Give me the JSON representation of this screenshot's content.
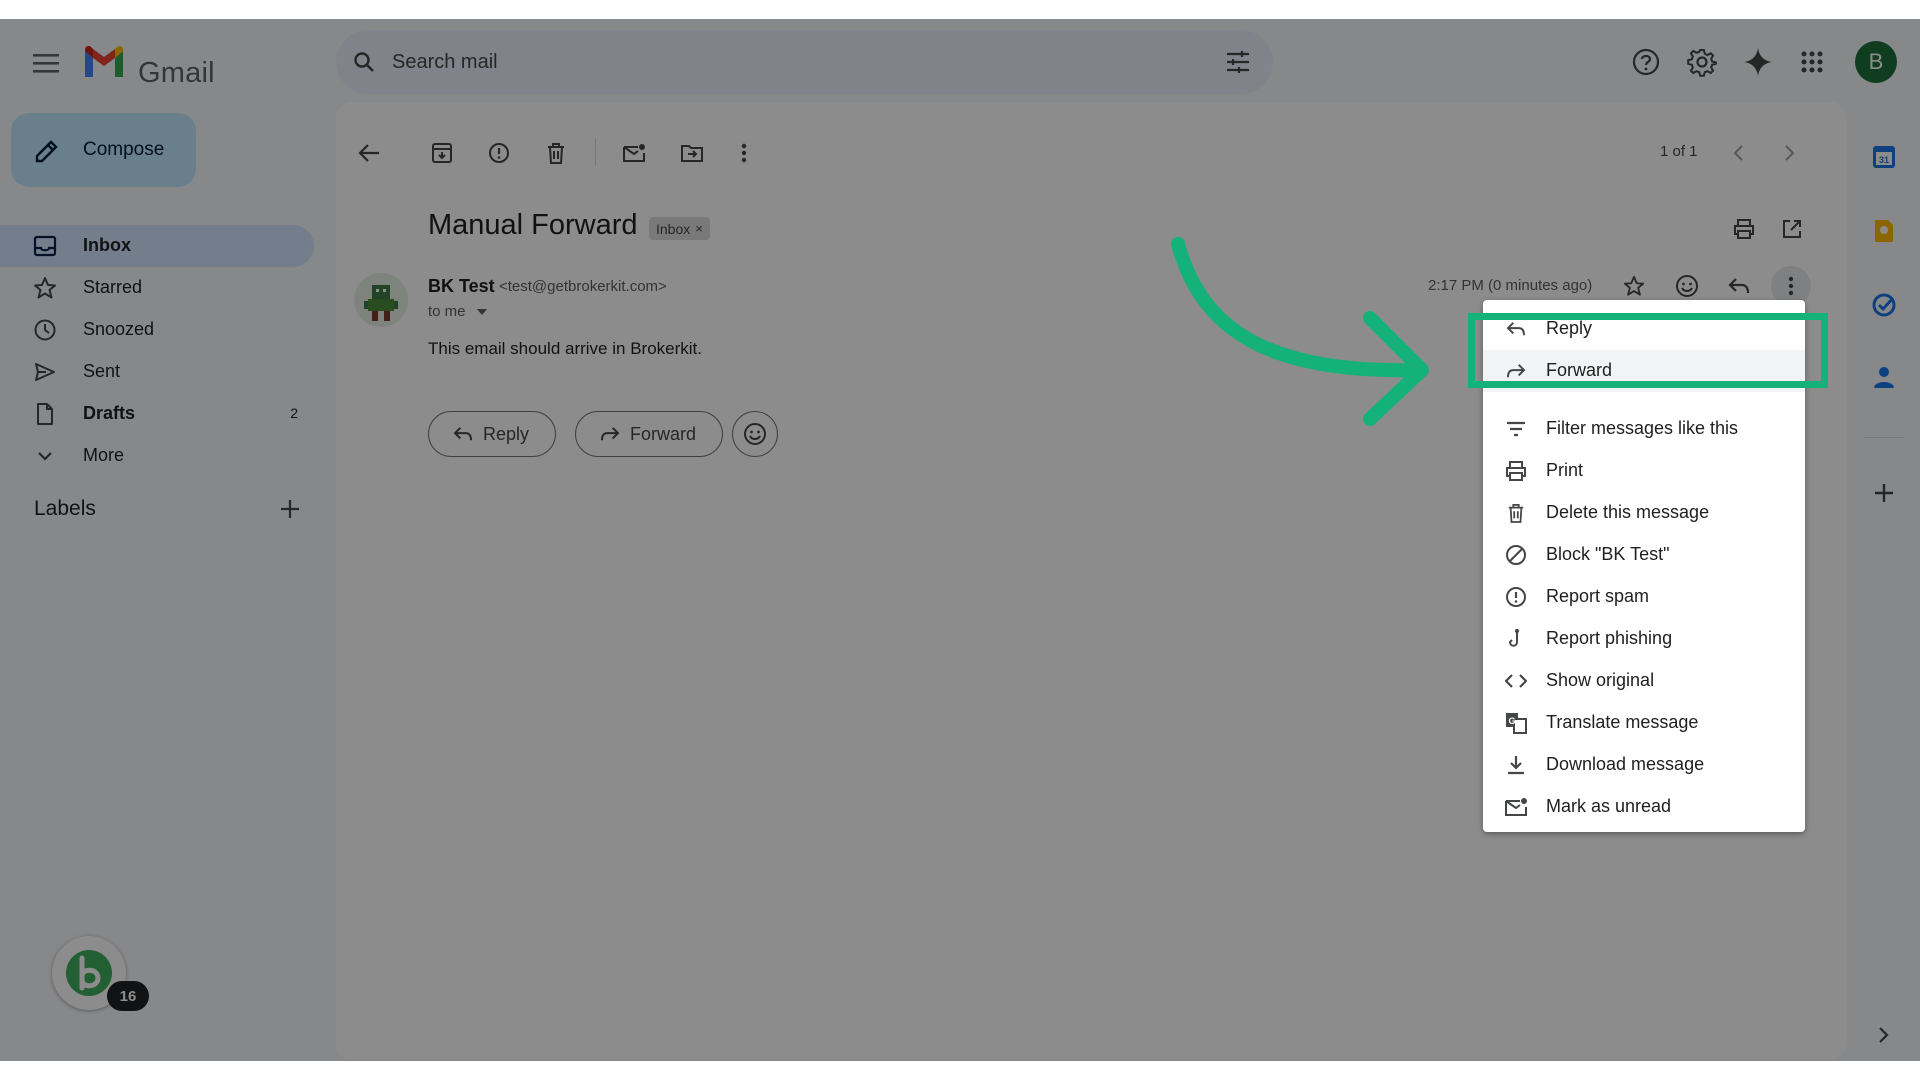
{
  "app": {
    "brand": "Gmail",
    "account_initial": "B"
  },
  "search": {
    "placeholder": "Search mail"
  },
  "header_icons": [
    "help-icon",
    "settings-icon",
    "gemini-icon",
    "apps-icon"
  ],
  "sidebar": {
    "compose_label": "Compose",
    "items": [
      {
        "label": "Inbox",
        "icon": "inbox-icon",
        "active": true,
        "count": ""
      },
      {
        "label": "Starred",
        "icon": "star-icon",
        "count": ""
      },
      {
        "label": "Snoozed",
        "icon": "clock-icon",
        "count": ""
      },
      {
        "label": "Sent",
        "icon": "send-icon",
        "count": ""
      },
      {
        "label": "Drafts",
        "icon": "draft-icon",
        "count": "2"
      },
      {
        "label": "More",
        "icon": "chevron-down-icon",
        "count": ""
      }
    ],
    "labels_title": "Labels",
    "brokerkit_badge": "16"
  },
  "toolbar": {
    "pager": "1 of 1"
  },
  "message": {
    "subject": "Manual Forward",
    "chip": "Inbox",
    "chip_remove": "×",
    "sender_name": "BK Test",
    "sender_email": "<test@getbrokerkit.com>",
    "to": "to me",
    "time": "2:17 PM (0 minutes ago)",
    "body": "This email should arrive in Brokerkit.",
    "reply_label": "Reply",
    "forward_label": "Forward"
  },
  "menu": {
    "items": [
      {
        "label": "Reply",
        "icon": "reply-icon"
      },
      {
        "label": "Forward",
        "icon": "forward-icon",
        "highlighted": true
      },
      {
        "label": "Filter messages like this",
        "icon": "filter-icon"
      },
      {
        "label": "Print",
        "icon": "print-icon"
      },
      {
        "label": "Delete this message",
        "icon": "trash-icon"
      },
      {
        "label": "Block \"BK Test\"",
        "icon": "block-icon"
      },
      {
        "label": "Report spam",
        "icon": "report-spam-icon"
      },
      {
        "label": "Report phishing",
        "icon": "phishing-icon"
      },
      {
        "label": "Show original",
        "icon": "code-icon"
      },
      {
        "label": "Translate message",
        "icon": "translate-icon"
      },
      {
        "label": "Download message",
        "icon": "download-icon"
      },
      {
        "label": "Mark as unread",
        "icon": "mark-unread-icon"
      }
    ]
  },
  "colors": {
    "highlight": "#14b27a",
    "compose_bg": "#c2e7ff",
    "active_nav": "#d3e3fd"
  }
}
